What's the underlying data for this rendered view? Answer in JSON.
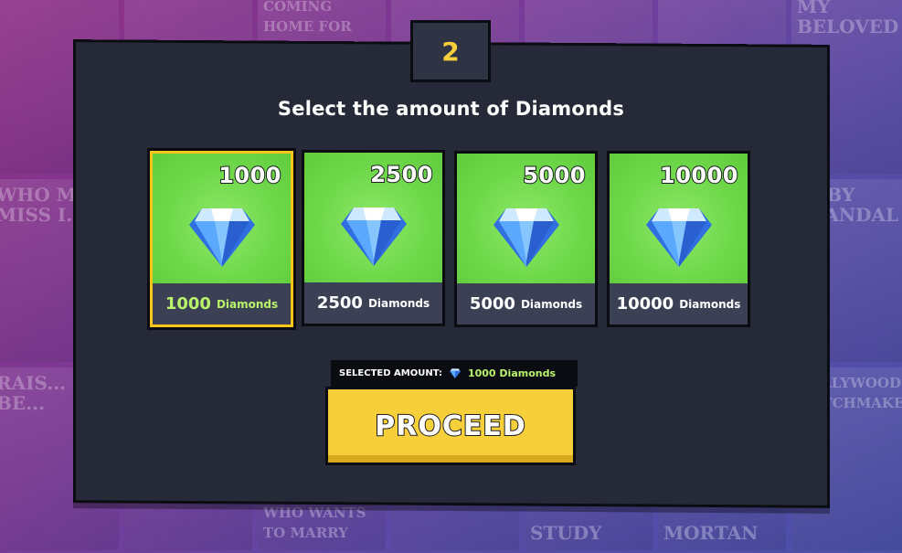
{
  "background": {
    "poster_titles": [
      "COMING HOME FOR CHRISTMAS",
      "MY BELOVED",
      "WHO MA... MISS I...",
      "BABY SCANDAL",
      "RAIS... MY BE...",
      "HOLLYWOOD MATCHMAKER",
      "WHO WANTS TO MARRY",
      "STUDY",
      "MORTAN"
    ]
  },
  "step": {
    "number": "2"
  },
  "title": "Select the amount of Diamonds",
  "cards": [
    {
      "amount": "1000",
      "count": "1000",
      "unit": "Diamonds",
      "selected": true
    },
    {
      "amount": "2500",
      "count": "2500",
      "unit": "Diamonds",
      "selected": false
    },
    {
      "amount": "5000",
      "count": "5000",
      "unit": "Diamonds",
      "selected": false
    },
    {
      "amount": "10000",
      "count": "10000",
      "unit": "Diamonds",
      "selected": false
    }
  ],
  "selection": {
    "label": "SELECTED AMOUNT:",
    "value": "1000 Diamonds",
    "icon": "diamond-icon"
  },
  "proceed_button": {
    "label": "PROCEED"
  },
  "colors": {
    "panel": "#262a38",
    "accent_yellow": "#f7cf3a",
    "card_green": "#6fd84a",
    "selected_text_green": "#b9f36a",
    "gem_blue": "#3b82f6"
  }
}
